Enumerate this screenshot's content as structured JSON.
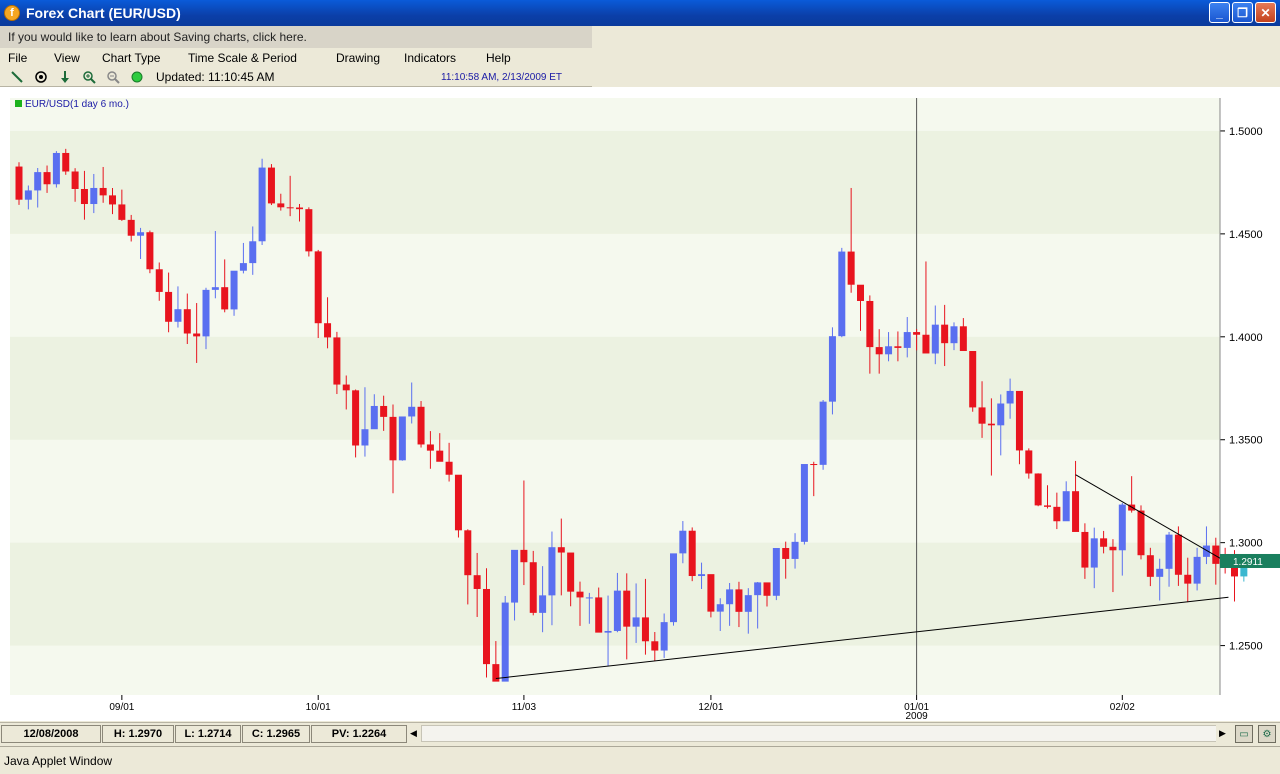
{
  "window": {
    "title": "Forex Chart (EUR/USD)",
    "controls": [
      "_",
      "❐",
      "✕"
    ]
  },
  "info_bar": {
    "text": "If you would like to learn about Saving charts, click here."
  },
  "menu": {
    "items": [
      "File",
      "View",
      "Chart Type",
      "Time Scale & Period",
      "Drawing",
      "Indicators",
      "Help"
    ]
  },
  "toolbar": {
    "icons": [
      "draw-line-icon",
      "target-icon",
      "down-arrow-icon",
      "zoom-in-icon",
      "zoom-out-icon",
      "status-dot-icon"
    ],
    "updated": "Updated: 11:10:45 AM",
    "timestamp": "11:10:58 AM, 2/13/2009 ET"
  },
  "status": {
    "date": "12/08/2008",
    "high": "H: 1.2970",
    "low": "L: 1.2714",
    "close": "C: 1.2965",
    "pv": "PV: 1.2264"
  },
  "footer": {
    "text": "Java Applet Window"
  },
  "chart_data": {
    "type": "candlestick",
    "legend": "EUR/USD(1 day  6 mo.)",
    "current_price_label": "1.2911",
    "y_ticks": [
      "1.5000",
      "1.4500",
      "1.4000",
      "1.3500",
      "1.3000",
      "1.2500"
    ],
    "ylim": [
      1.226,
      1.516
    ],
    "x_ticks": [
      {
        "label": "09/01",
        "index": 11
      },
      {
        "label": "10/01",
        "index": 32
      },
      {
        "label": "11/03",
        "index": 54
      },
      {
        "label": "12/01",
        "index": 74
      },
      {
        "label": "01/01",
        "sublabel": "2009",
        "index": 96
      },
      {
        "label": "02/02",
        "index": 118
      }
    ],
    "up_color": "#5a6ff0",
    "down_color": "#e8141e",
    "last_color": "#3bb7cf",
    "trendlines": [
      {
        "from": [
          51,
          1.234
        ],
        "to": [
          127,
          1.273
        ]
      },
      {
        "from": [
          113,
          1.333
        ],
        "to": [
          127,
          1.294
        ]
      }
    ],
    "vertical_marker_index": 96,
    "candles": [
      [
        1.4827,
        1.4848,
        1.4641,
        1.4666
      ],
      [
        1.4666,
        1.4735,
        1.4619,
        1.4711
      ],
      [
        1.4711,
        1.482,
        1.4628,
        1.48
      ],
      [
        1.48,
        1.4832,
        1.4699,
        1.4741
      ],
      [
        1.4741,
        1.4902,
        1.4725,
        1.4893
      ],
      [
        1.4893,
        1.4913,
        1.4787,
        1.4803
      ],
      [
        1.4803,
        1.4819,
        1.4656,
        1.4718
      ],
      [
        1.4718,
        1.4806,
        1.4569,
        1.4645
      ],
      [
        1.4645,
        1.4791,
        1.4601,
        1.4723
      ],
      [
        1.4723,
        1.4825,
        1.4651,
        1.4687
      ],
      [
        1.4687,
        1.4723,
        1.4596,
        1.4643
      ],
      [
        1.4643,
        1.4715,
        1.4563,
        1.4568
      ],
      [
        1.4568,
        1.4592,
        1.4463,
        1.4491
      ],
      [
        1.4491,
        1.4529,
        1.4378,
        1.4508
      ],
      [
        1.4508,
        1.4516,
        1.4309,
        1.4328
      ],
      [
        1.4328,
        1.4361,
        1.4175,
        1.4218
      ],
      [
        1.4218,
        1.4312,
        1.4022,
        1.4073
      ],
      [
        1.4073,
        1.4245,
        1.4045,
        1.4134
      ],
      [
        1.4134,
        1.421,
        1.3965,
        1.4016
      ],
      [
        1.4016,
        1.4164,
        1.3873,
        1.4002
      ],
      [
        1.4002,
        1.4238,
        1.394,
        1.4228
      ],
      [
        1.4228,
        1.4514,
        1.4187,
        1.4241
      ],
      [
        1.4241,
        1.4376,
        1.4119,
        1.4133
      ],
      [
        1.4133,
        1.4319,
        1.4102,
        1.4321
      ],
      [
        1.4321,
        1.4456,
        1.4308,
        1.4358
      ],
      [
        1.4358,
        1.4536,
        1.4301,
        1.4464
      ],
      [
        1.4464,
        1.4865,
        1.4446,
        1.4822
      ],
      [
        1.4822,
        1.4839,
        1.464,
        1.4648
      ],
      [
        1.4648,
        1.4695,
        1.4613,
        1.4629
      ],
      [
        1.4629,
        1.4782,
        1.4586,
        1.4628
      ],
      [
        1.4628,
        1.4645,
        1.456,
        1.462
      ],
      [
        1.462,
        1.4629,
        1.439,
        1.4415
      ],
      [
        1.4415,
        1.4422,
        1.3994,
        1.4066
      ],
      [
        1.4066,
        1.4192,
        1.3944,
        1.3997
      ],
      [
        1.3997,
        1.4024,
        1.3722,
        1.3768
      ],
      [
        1.3768,
        1.3812,
        1.3647,
        1.374
      ],
      [
        1.374,
        1.3744,
        1.3414,
        1.3472
      ],
      [
        1.3472,
        1.3755,
        1.3418,
        1.3551
      ],
      [
        1.3551,
        1.3721,
        1.3555,
        1.3664
      ],
      [
        1.3664,
        1.3714,
        1.3543,
        1.3611
      ],
      [
        1.3611,
        1.3671,
        1.324,
        1.34
      ],
      [
        1.34,
        1.361,
        1.3398,
        1.3613
      ],
      [
        1.3613,
        1.3778,
        1.3579,
        1.366
      ],
      [
        1.366,
        1.3688,
        1.3462,
        1.3477
      ],
      [
        1.3477,
        1.3542,
        1.3359,
        1.3447
      ],
      [
        1.3447,
        1.3532,
        1.3409,
        1.3393
      ],
      [
        1.3393,
        1.3485,
        1.3297,
        1.333
      ],
      [
        1.333,
        1.3319,
        1.3025,
        1.306
      ],
      [
        1.306,
        1.3065,
        1.27,
        1.2842
      ],
      [
        1.2842,
        1.295,
        1.2639,
        1.2775
      ],
      [
        1.2775,
        1.2876,
        1.2345,
        1.241
      ],
      [
        1.241,
        1.2522,
        1.2333,
        1.2325
      ],
      [
        1.2325,
        1.2741,
        1.2352,
        1.2709
      ],
      [
        1.2709,
        1.2937,
        1.2622,
        1.2965
      ],
      [
        1.2965,
        1.3302,
        1.2794,
        1.2905
      ],
      [
        1.2905,
        1.296,
        1.2647,
        1.2659
      ],
      [
        1.2659,
        1.2886,
        1.2565,
        1.2744
      ],
      [
        1.2744,
        1.3054,
        1.2599,
        1.2978
      ],
      [
        1.2978,
        1.3117,
        1.2744,
        1.2952
      ],
      [
        1.2952,
        1.2949,
        1.2691,
        1.2762
      ],
      [
        1.2762,
        1.2811,
        1.2596,
        1.2734
      ],
      [
        1.2734,
        1.2756,
        1.2606,
        1.2734
      ],
      [
        1.2734,
        1.2782,
        1.2567,
        1.2563
      ],
      [
        1.2563,
        1.2743,
        1.2401,
        1.2571
      ],
      [
        1.2571,
        1.2853,
        1.2565,
        1.2767
      ],
      [
        1.2767,
        1.2851,
        1.2433,
        1.2592
      ],
      [
        1.2592,
        1.2802,
        1.2513,
        1.2637
      ],
      [
        1.2637,
        1.2824,
        1.2456,
        1.2521
      ],
      [
        1.2521,
        1.2566,
        1.2425,
        1.2476
      ],
      [
        1.2476,
        1.2656,
        1.244,
        1.2614
      ],
      [
        1.2614,
        1.2907,
        1.2597,
        1.2948
      ],
      [
        1.2948,
        1.3105,
        1.29,
        1.3058
      ],
      [
        1.3058,
        1.3074,
        1.2813,
        1.2838
      ],
      [
        1.2838,
        1.2903,
        1.2775,
        1.2847
      ],
      [
        1.2847,
        1.2831,
        1.2637,
        1.2665
      ],
      [
        1.2665,
        1.273,
        1.2571,
        1.2701
      ],
      [
        1.2701,
        1.2804,
        1.2596,
        1.2773
      ],
      [
        1.2773,
        1.281,
        1.259,
        1.2664
      ],
      [
        1.2664,
        1.2779,
        1.2558,
        1.2745
      ],
      [
        1.2745,
        1.2809,
        1.2583,
        1.2807
      ],
      [
        1.2807,
        1.2791,
        1.269,
        1.2742
      ],
      [
        1.2742,
        1.2968,
        1.2721,
        1.2974
      ],
      [
        1.2974,
        1.3005,
        1.2825,
        1.2921
      ],
      [
        1.2921,
        1.3046,
        1.2874,
        1.3004
      ],
      [
        1.3004,
        1.3371,
        1.2991,
        1.3382
      ],
      [
        1.3382,
        1.3393,
        1.3226,
        1.3378
      ],
      [
        1.3378,
        1.3693,
        1.3354,
        1.3685
      ],
      [
        1.3685,
        1.4046,
        1.3623,
        1.4003
      ],
      [
        1.4003,
        1.4432,
        1.3998,
        1.4414
      ],
      [
        1.4414,
        1.4723,
        1.4214,
        1.4253
      ],
      [
        1.4253,
        1.4236,
        1.4029,
        1.4174
      ],
      [
        1.4174,
        1.4201,
        1.3821,
        1.395
      ],
      [
        1.395,
        1.4037,
        1.3821,
        1.3915
      ],
      [
        1.3915,
        1.4023,
        1.3881,
        1.3954
      ],
      [
        1.3954,
        1.4026,
        1.3881,
        1.3946
      ],
      [
        1.3946,
        1.4096,
        1.39,
        1.4023
      ],
      [
        1.4023,
        1.4038,
        1.3934,
        1.401
      ],
      [
        1.401,
        1.4366,
        1.3944,
        1.3919
      ],
      [
        1.3919,
        1.4152,
        1.3867,
        1.4059
      ],
      [
        1.4059,
        1.4155,
        1.3858,
        1.3969
      ],
      [
        1.3969,
        1.407,
        1.3935,
        1.4051
      ],
      [
        1.4051,
        1.4091,
        1.3952,
        1.3931
      ],
      [
        1.3931,
        1.3922,
        1.3636,
        1.3657
      ],
      [
        1.3657,
        1.3784,
        1.3509,
        1.3578
      ],
      [
        1.3578,
        1.3701,
        1.3326,
        1.357
      ],
      [
        1.357,
        1.372,
        1.3424,
        1.3676
      ],
      [
        1.3676,
        1.3797,
        1.3602,
        1.3737
      ],
      [
        1.3737,
        1.3736,
        1.3381,
        1.3448
      ],
      [
        1.3448,
        1.3458,
        1.3311,
        1.3336
      ],
      [
        1.3336,
        1.3337,
        1.3177,
        1.3181
      ],
      [
        1.3181,
        1.3279,
        1.3166,
        1.3174
      ],
      [
        1.3174,
        1.3243,
        1.3066,
        1.3104
      ],
      [
        1.3104,
        1.3298,
        1.3107,
        1.325
      ],
      [
        1.325,
        1.3397,
        1.3078,
        1.3052
      ],
      [
        1.3052,
        1.3094,
        1.2824,
        1.2879
      ],
      [
        1.2879,
        1.3073,
        1.2779,
        1.3021
      ],
      [
        1.3021,
        1.3057,
        1.2948,
        1.298
      ],
      [
        1.298,
        1.3017,
        1.276,
        1.2963
      ],
      [
        1.2963,
        1.3193,
        1.284,
        1.3185
      ],
      [
        1.3185,
        1.3323,
        1.3146,
        1.3156
      ],
      [
        1.3156,
        1.3181,
        1.2919,
        1.2939
      ],
      [
        1.2939,
        1.2975,
        1.2789,
        1.2834
      ],
      [
        1.2834,
        1.2922,
        1.2719,
        1.2873
      ],
      [
        1.2873,
        1.3052,
        1.2786,
        1.3039
      ],
      [
        1.3039,
        1.3079,
        1.279,
        1.2844
      ],
      [
        1.2844,
        1.2927,
        1.2711,
        1.2801
      ],
      [
        1.2801,
        1.2975,
        1.2768,
        1.2931
      ],
      [
        1.2931,
        1.3079,
        1.2896,
        1.2986
      ],
      [
        1.2986,
        1.3024,
        1.2796,
        1.2897
      ],
      [
        1.2897,
        1.2975,
        1.285,
        1.2878
      ],
      [
        1.2878,
        1.2964,
        1.2714,
        1.2836
      ],
      [
        1.2836,
        1.2938,
        1.2811,
        1.2911
      ]
    ]
  }
}
